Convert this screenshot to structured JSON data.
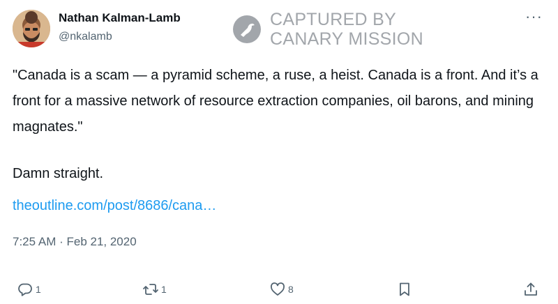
{
  "author": {
    "name": "Nathan Kalman-Lamb",
    "handle": "@nkalamb"
  },
  "watermark": {
    "line1": "CAPTURED BY",
    "line2": "CANARY MISSION",
    "logo_icon": "canary-bird-icon"
  },
  "more_icon": "more-horizontal-icon",
  "tweet": {
    "text_quote": "\"Canada is a scam — a pyramid scheme, a ruse, a heist. Canada is a front. And it’s a front for a massive network of resource extraction companies, oil barons, and mining magnates.\"",
    "text_comment": "Damn straight.",
    "link": "theoutline.com/post/8686/cana…",
    "timestamp": "7:25 AM · Feb 21, 2020"
  },
  "actions": {
    "reply_count": "1",
    "retweet_count": "1",
    "like_count": "8",
    "bookmark_icon": "bookmark-icon",
    "share_icon": "share-icon"
  },
  "colors": {
    "text": "#0f1419",
    "muted": "#536471",
    "link": "#1d9bf0",
    "watermark": "#a2a6ab"
  }
}
